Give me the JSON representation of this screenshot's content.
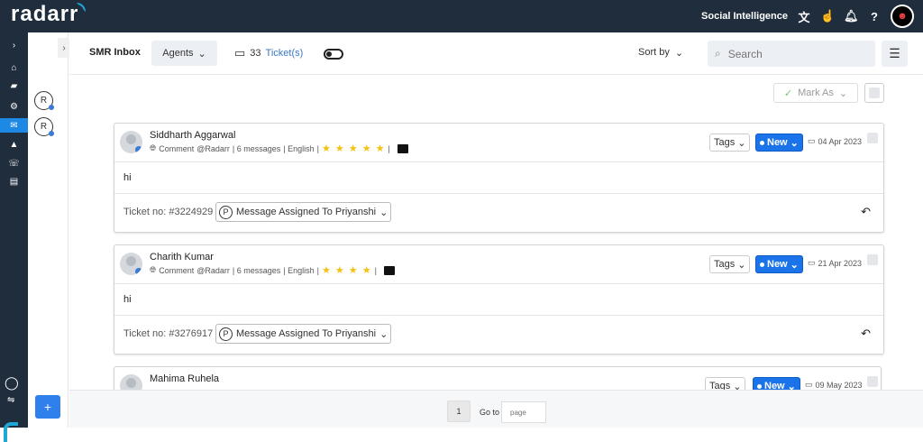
{
  "app": {
    "logo_text": "radarr",
    "product_name": "Social Intelligence"
  },
  "topbar": {
    "icons": [
      "translate-icon",
      "hand-pointer-icon",
      "bell-icon",
      "help-icon",
      "user-avatar"
    ]
  },
  "leftnav": {
    "icons": [
      "chevron-right-icon",
      "home-icon",
      "tag-icon",
      "settings-icon",
      "inbox-icon",
      "chart-icon",
      "chat-icon",
      "report-icon",
      "support-icon",
      "sync-icon"
    ],
    "active": "inbox-icon"
  },
  "agents_panel": {
    "avatars": [
      "R",
      "R"
    ],
    "add_label": "+"
  },
  "header": {
    "title": "SMR Inbox",
    "agents_label": "Agents",
    "ticket_count": "33",
    "ticket_label": "Ticket(s)",
    "sort_label": "Sort by",
    "search_placeholder": "Search"
  },
  "toolbar": {
    "mark_as_label": "Mark As"
  },
  "tickets": [
    {
      "name": "Siddharth Aggarwal",
      "type": "Comment",
      "handle": "@Radarr",
      "messages": "| 6 messages",
      "language": "| English",
      "rating_stars": 5,
      "stars": "★ ★ ★ ★ ★",
      "tags_label": "Tags",
      "status": "New",
      "date": "04 Apr 2023",
      "message": "hi",
      "ticket_no": "Ticket no: #3224929",
      "assignee_initial": "P",
      "assignment": "Message Assigned To Priyanshi"
    },
    {
      "name": "Charith Kumar",
      "type": "Comment",
      "handle": "@Radarr",
      "messages": "| 6 messages",
      "language": "| English",
      "rating_stars": 4,
      "stars": "★ ★ ★ ★",
      "tags_label": "Tags",
      "status": "New",
      "date": "21 Apr 2023",
      "message": "hi",
      "ticket_no": "Ticket no: #3276917",
      "assignee_initial": "P",
      "assignment": "Message Assigned To Priyanshi"
    },
    {
      "name": "Mahima Ruhela",
      "tags_label": "Tags",
      "status": "New",
      "date": "09 May 2023"
    }
  ],
  "pagination": {
    "current_page": "1",
    "goto_label": "Go to",
    "page_placeholder": "page"
  },
  "colors": {
    "topbar": "#1f2d3d",
    "accent": "#1a73e8",
    "star": "#f4c20d"
  }
}
